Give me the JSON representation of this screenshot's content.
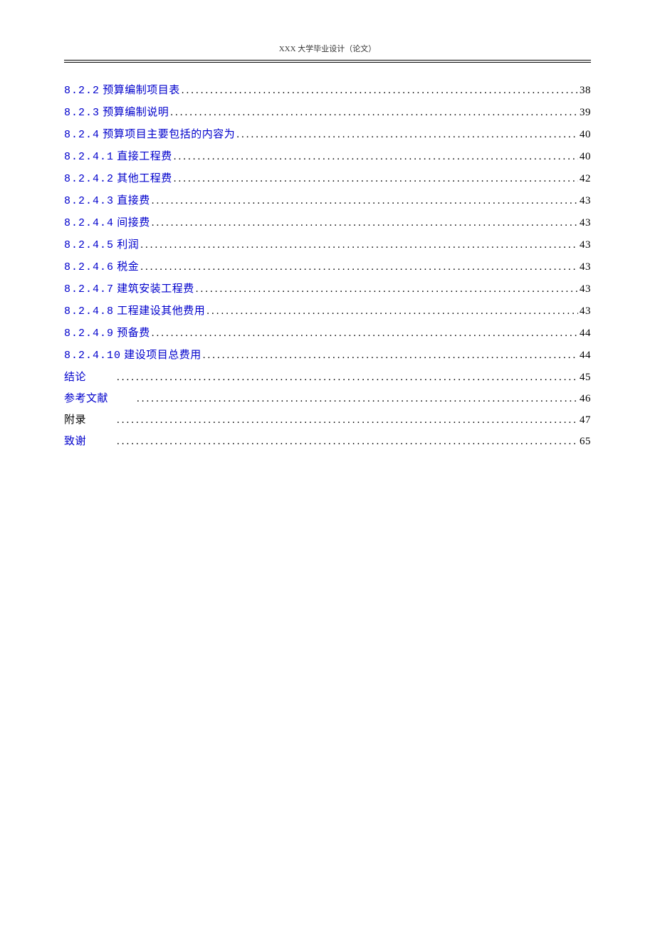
{
  "header": {
    "title": "XXX 大学毕业设计（论文）"
  },
  "toc": {
    "entries": [
      {
        "number": "8.2.2",
        "title": "预算编制项目表",
        "page": "38",
        "link": true
      },
      {
        "number": "8.2.3",
        "title": "预算编制说明",
        "page": "39",
        "link": true
      },
      {
        "number": "8.2.4",
        "title": "预算项目主要包括的内容为",
        "page": "40",
        "link": true
      },
      {
        "number": "8.2.4.1",
        "title": "直接工程费",
        "page": "40",
        "link": true
      },
      {
        "number": "8.2.4.2",
        "title": "其他工程费",
        "page": "42",
        "link": true
      },
      {
        "number": "8.2.4.3",
        "title": "直接费",
        "page": "43",
        "link": true
      },
      {
        "number": "8.2.4.4",
        "title": "间接费",
        "page": "43",
        "link": true
      },
      {
        "number": "8.2.4.5",
        "title": "利润",
        "page": "43",
        "link": true
      },
      {
        "number": "8.2.4.6",
        "title": "税金",
        "page": "43",
        "link": true
      },
      {
        "number": "8.2.4.7",
        "title": "建筑安装工程费",
        "page": "43",
        "link": true
      },
      {
        "number": "8.2.4.8",
        "title": "工程建设其他费用",
        "page": "43",
        "link": true
      },
      {
        "number": "8.2.4.9",
        "title": "预备费",
        "page": "44",
        "link": true
      },
      {
        "number": "8.2.4.10",
        "title": "建设项目总费用",
        "page": "44",
        "link": true
      },
      {
        "number": "",
        "title": "结论",
        "page": "45",
        "link": true,
        "gap": true
      },
      {
        "number": "",
        "title": "参考文献",
        "page": "46",
        "link": true,
        "gap": true
      },
      {
        "number": "",
        "title": "附录",
        "page": "47",
        "link": false,
        "gap": true
      },
      {
        "number": "",
        "title": "致谢",
        "page": "65",
        "link": true,
        "gap": true
      }
    ]
  }
}
